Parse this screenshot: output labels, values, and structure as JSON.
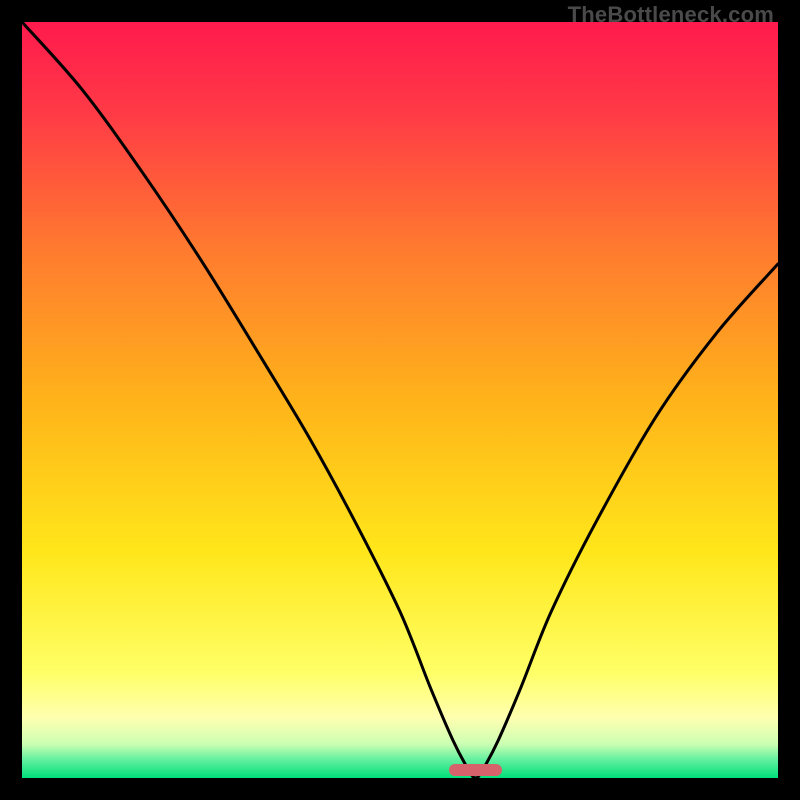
{
  "watermark": {
    "text": "TheBottleneck.com"
  },
  "colors": {
    "background": "#000000",
    "gradient_stops": [
      {
        "offset": 0.0,
        "color": "#ff1a4d"
      },
      {
        "offset": 0.12,
        "color": "#ff3a46"
      },
      {
        "offset": 0.3,
        "color": "#ff7a2f"
      },
      {
        "offset": 0.5,
        "color": "#ffb31a"
      },
      {
        "offset": 0.7,
        "color": "#ffe61a"
      },
      {
        "offset": 0.86,
        "color": "#ffff66"
      },
      {
        "offset": 0.92,
        "color": "#ffffb0"
      },
      {
        "offset": 0.955,
        "color": "#ccffb3"
      },
      {
        "offset": 0.975,
        "color": "#66f0a0"
      },
      {
        "offset": 1.0,
        "color": "#00e07a"
      }
    ],
    "curve": "#000000",
    "marker": "#d6636b"
  },
  "chart_data": {
    "type": "line",
    "title": "",
    "xlabel": "",
    "ylabel": "",
    "xlim": [
      0,
      100
    ],
    "ylim": [
      0,
      100
    ],
    "series": [
      {
        "name": "bottleneck-curve",
        "x": [
          0,
          8,
          16,
          24,
          32,
          38,
          44,
          50,
          54,
          57,
          59,
          60,
          61,
          63,
          66,
          70,
          76,
          84,
          92,
          100
        ],
        "values": [
          100,
          91,
          80,
          68,
          55,
          45,
          34,
          22,
          12,
          5,
          1.2,
          0,
          1.2,
          5,
          12,
          22,
          34,
          48,
          59,
          68
        ]
      }
    ],
    "marker": {
      "x_start": 56.5,
      "x_end": 63.5,
      "y": 0
    }
  }
}
